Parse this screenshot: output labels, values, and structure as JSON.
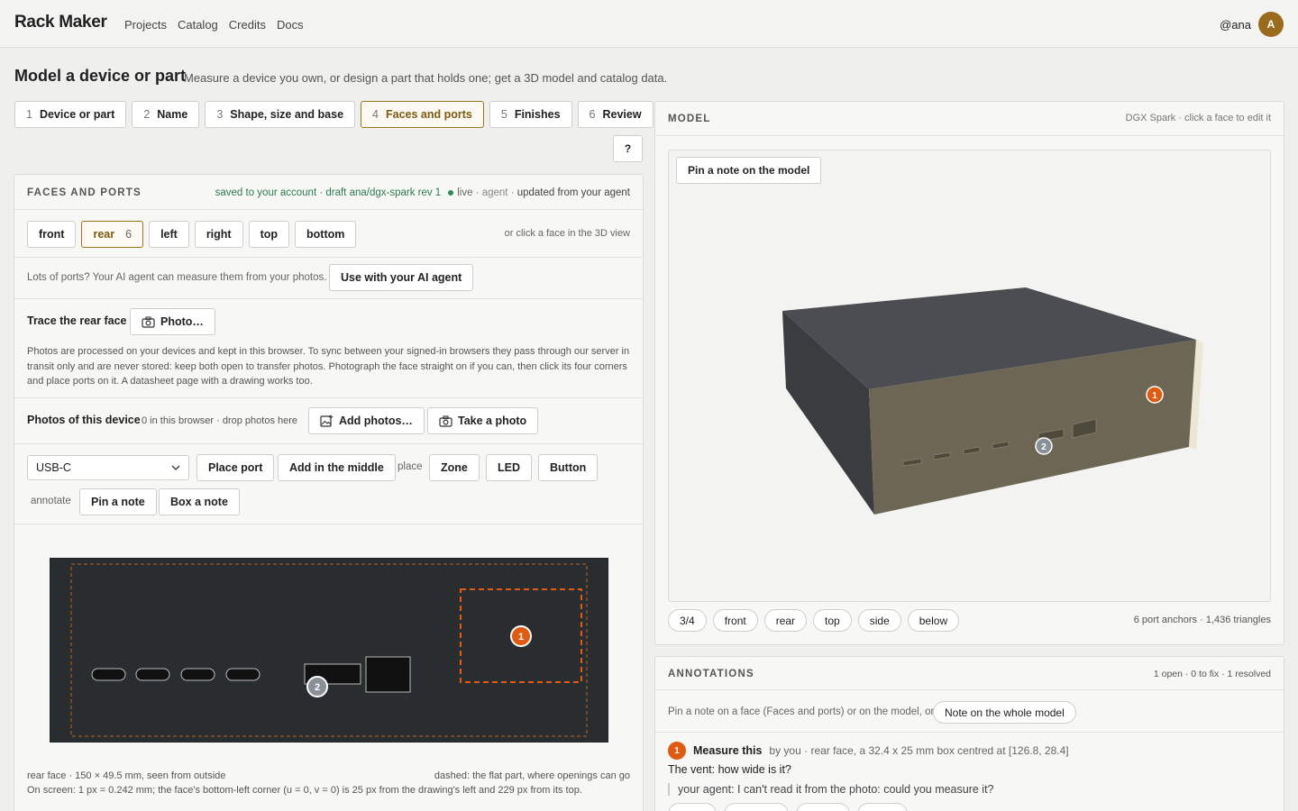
{
  "app": {
    "brand": "Rack Maker",
    "nav": [
      "Projects",
      "Catalog",
      "Credits",
      "Docs"
    ],
    "user": "@ana",
    "avatar_letter": "A"
  },
  "page": {
    "title": "Model a device or part",
    "subtitle": "Measure a device you own, or design a part that holds one; get a 3D model and catalog data."
  },
  "steps": [
    {
      "num": "1",
      "label": "Device or part"
    },
    {
      "num": "2",
      "label": "Name"
    },
    {
      "num": "3",
      "label": "Shape, size and base"
    },
    {
      "num": "4",
      "label": "Faces and ports",
      "active": true
    },
    {
      "num": "5",
      "label": "Finishes"
    },
    {
      "num": "6",
      "label": "Review"
    }
  ],
  "help": "?",
  "faces": {
    "header": "FACES AND PORTS",
    "saved": "saved to your account · draft ana/dgx-spark rev 1",
    "live": "live",
    "agent_status": " · agent · ",
    "updated": "updated from your agent",
    "tabs": [
      {
        "label": "front"
      },
      {
        "label": "rear",
        "count": "6",
        "selected": true
      },
      {
        "label": "left"
      },
      {
        "label": "right"
      },
      {
        "label": "top"
      },
      {
        "label": "bottom"
      }
    ],
    "click_hint": "or click a face in the 3D view",
    "agent_hint": "Lots of ports? Your AI agent can measure them from your photos.",
    "agent_button": "Use with your AI agent",
    "trace_label": "Trace the rear face",
    "photo_button": "Photo…",
    "privacy_text": "Photos are processed on your devices and kept in this browser. To sync between your signed-in browsers they pass through our server in transit only and are never stored: keep both open to transfer photos. Photograph the face straight on if you can, then click its four corners and place ports on it. A datasheet page with a drawing works too.",
    "photos_label": "Photos of this device",
    "photos_hint": "0 in this browser · drop photos here",
    "add_photos": "Add photos…",
    "take_photo": "Take a photo",
    "port_type": "USB-C",
    "place_port": "Place port",
    "add_middle": "Add in the middle",
    "place_label": "place",
    "zone": "Zone",
    "led": "LED",
    "button": "Button",
    "annotate_label": "annotate",
    "pin_note": "Pin a note",
    "box_note": "Box a note",
    "caption_left": "rear face · 150 × 49.5 mm, seen from outside",
    "caption_right": "dashed: the flat part, where openings can go",
    "screen_note": "On screen: 1 px = 0.242 mm; the face's bottom-left corner (u = 0, v = 0) is 25 px from the drawing's left and 229 px from its top.",
    "marker1": "1",
    "marker2": "2"
  },
  "model": {
    "header": "MODEL",
    "hint": "DGX Spark · click a face to edit it",
    "pin_button": "Pin a note on the model",
    "views": [
      "3/4",
      "front",
      "rear",
      "top",
      "side",
      "below"
    ],
    "stats": "6 port anchors · 1,436 triangles",
    "marker1": "1",
    "marker2": "2"
  },
  "annotations": {
    "header": "ANNOTATIONS",
    "summary": "1 open · 0 to fix · 1 resolved",
    "hint": "Pin a note on a face (Faces and ports) or on the model, or",
    "whole_button": "Note on the whole model",
    "item": {
      "num": "1",
      "title": "Measure this",
      "meta": "by you · rear face, a 32.4 x 25 mm box centred at [126.8, 28.4]",
      "question": "The vent: how wide is it?",
      "reply": "your agent: I can't read it from the photo: could you measure it?"
    }
  },
  "colors": {
    "accent": "#9a7620",
    "marker": "#e05a10",
    "marker2": "#8a9099",
    "live": "#2e8b57"
  }
}
